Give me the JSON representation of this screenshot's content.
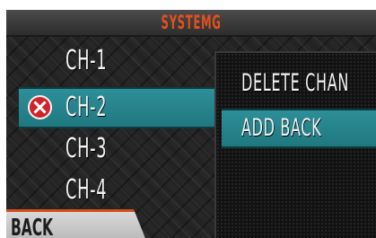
{
  "header": {
    "title": "SYSTEMG"
  },
  "channels": [
    {
      "label": "CH-1",
      "selected": false,
      "marked_for_delete": false
    },
    {
      "label": "CH-2",
      "selected": true,
      "marked_for_delete": true
    },
    {
      "label": "CH-3",
      "selected": false,
      "marked_for_delete": false
    },
    {
      "label": "CH-4",
      "selected": false,
      "marked_for_delete": false
    }
  ],
  "footer": {
    "back_label": "BACK"
  },
  "context_menu": {
    "items": [
      {
        "label": "DELETE CHAN",
        "highlighted": false
      },
      {
        "label": "ADD BACK",
        "highlighted": true
      }
    ]
  },
  "colors": {
    "title_text": "#e2501f",
    "selection": "#2d8f98",
    "delete_icon": "#d0232a",
    "back_accent": "#d44f1f"
  },
  "icons": {
    "delete_marker": "x-circle-icon"
  }
}
